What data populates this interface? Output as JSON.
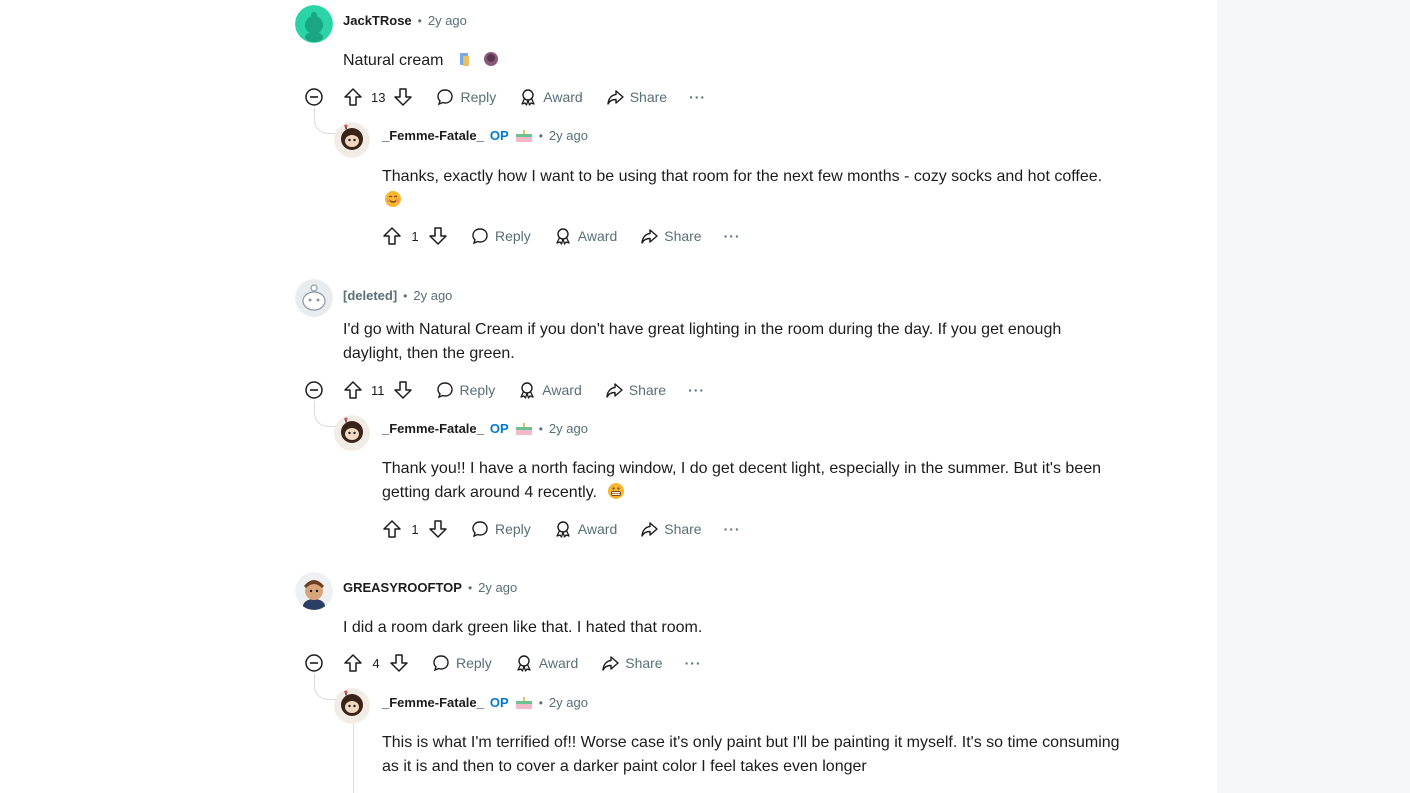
{
  "comments": [
    {
      "author": "JackTRose",
      "age": "2y ago",
      "text": "Natural cream",
      "votes": "13",
      "reply": "Reply",
      "award": "Award",
      "share": "Share",
      "more": "···",
      "reply_child": {
        "author": "_Femme-Fatale_",
        "op": "OP",
        "age": "2y ago",
        "text": "Thanks, exactly how I want to be using that room for the next few months - cozy socks and hot coffee.",
        "votes": "1",
        "reply": "Reply",
        "award": "Award",
        "share": "Share",
        "more": "···"
      }
    },
    {
      "author": "[deleted]",
      "age": "2y ago",
      "text_line1": "I'd go with Natural Cream if you don't have great lighting in the room during the day. If you get enough",
      "text_line2": "daylight, then the green.",
      "votes": "11",
      "reply": "Reply",
      "award": "Award",
      "share": "Share",
      "more": "···",
      "reply_child": {
        "author": "_Femme-Fatale_",
        "op": "OP",
        "age": "2y ago",
        "text_line1": "Thank you!! I have a north facing window, I do get decent light, especially in the summer. But it's been",
        "text_line2": "getting dark around 4 recently.",
        "votes": "1",
        "reply": "Reply",
        "award": "Award",
        "share": "Share",
        "more": "···"
      }
    },
    {
      "author": "GREASYROOFTOP",
      "age": "2y ago",
      "text": "I did a room dark green like that. I hated that room.",
      "votes": "4",
      "reply": "Reply",
      "award": "Award",
      "share": "Share",
      "more": "···",
      "reply_child": {
        "author": "_Femme-Fatale_",
        "op": "OP",
        "age": "2y ago",
        "text_line1": "This is what I'm terrified of!! Worse case it's only paint but I'll be painting it myself. It's so time consuming",
        "text_line2": "as it is and then to cover a darker paint color I feel takes even longer"
      }
    }
  ],
  "separator": "•",
  "colors": {
    "op": "#0079d3",
    "meta": "#576f76",
    "text": "#1c1c1c",
    "thread": "#d7dadc",
    "avatar_teal": "#2ad4a6"
  },
  "icons": [
    "upvote-icon",
    "downvote-icon",
    "reply-bubble-icon",
    "award-icon",
    "share-arrow-icon",
    "collapse-minus-icon",
    "cake-flair-icon"
  ]
}
